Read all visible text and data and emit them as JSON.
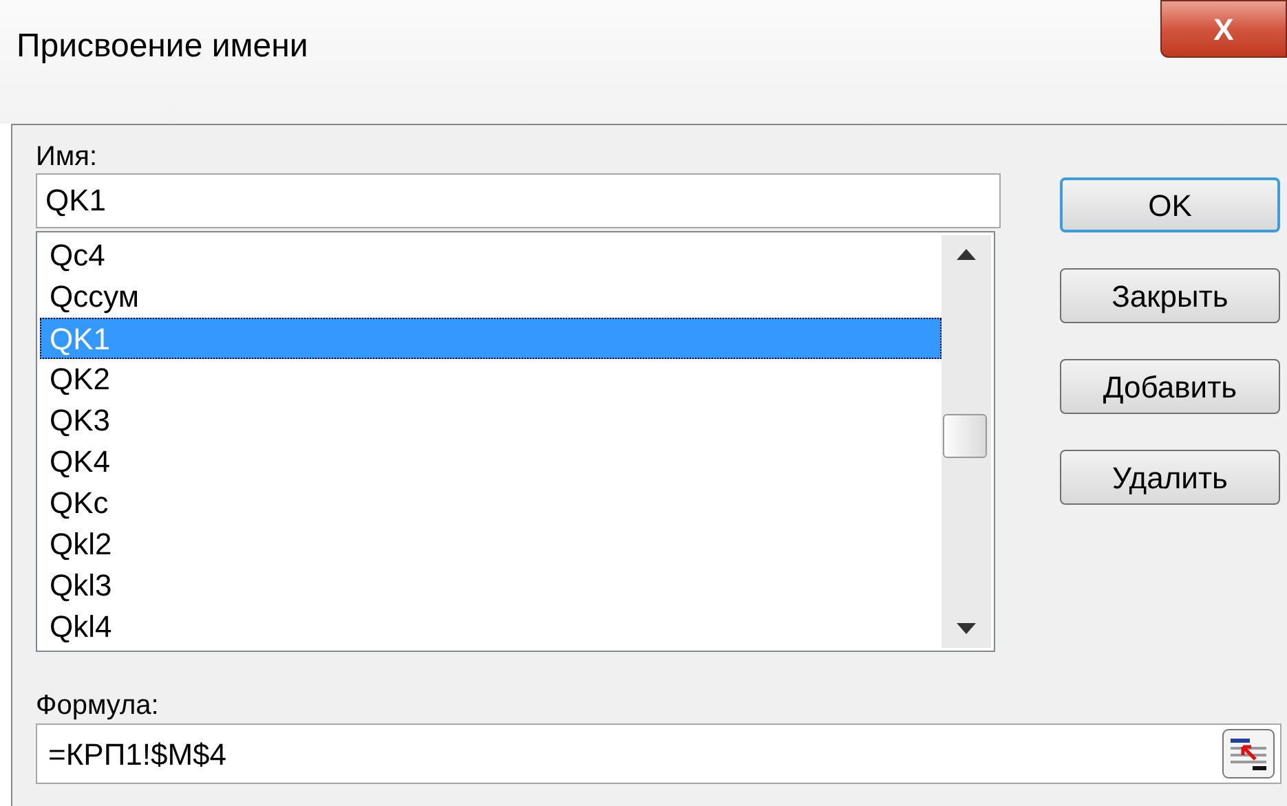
{
  "window": {
    "title": "Присвоение имени",
    "close": "X"
  },
  "name_label": "Имя:",
  "name_field": {
    "value": "QK1"
  },
  "names_list": [
    {
      "label": "Qc4",
      "selected": false
    },
    {
      "label": "Qccум",
      "selected": false
    },
    {
      "label": "QK1",
      "selected": true
    },
    {
      "label": "QK2",
      "selected": false
    },
    {
      "label": "QK3",
      "selected": false
    },
    {
      "label": "QK4",
      "selected": false
    },
    {
      "label": "QKc",
      "selected": false
    },
    {
      "label": "Qkl2",
      "selected": false
    },
    {
      "label": "Qkl3",
      "selected": false
    },
    {
      "label": "Qkl4",
      "selected": false
    }
  ],
  "buttons": [
    {
      "label": "OK",
      "default": true
    },
    {
      "label": "Закрыть",
      "default": false
    },
    {
      "label": "Добавить",
      "default": false
    },
    {
      "label": "Удалить",
      "default": false
    }
  ],
  "formula_label": "Формула:",
  "formula_field": {
    "value": "=КРП1!$M$4"
  }
}
